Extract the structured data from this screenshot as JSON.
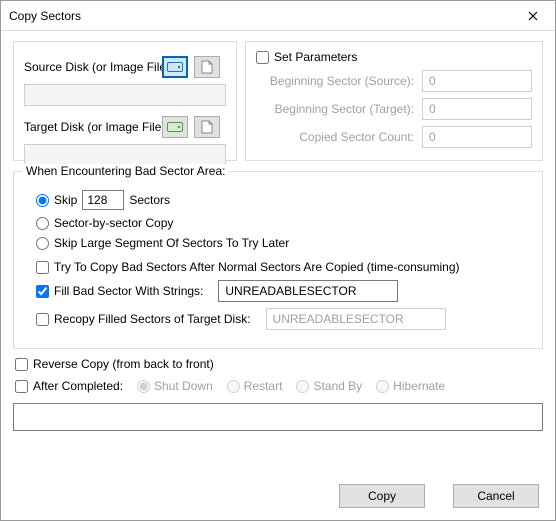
{
  "window": {
    "title": "Copy Sectors"
  },
  "disks": {
    "source_label": "Source Disk (or Image File)",
    "target_label": "Target Disk (or Image File)",
    "source_path": "",
    "target_path": ""
  },
  "params": {
    "set_label": "Set Parameters",
    "set_checked": false,
    "begin_source_label": "Beginning Sector (Source):",
    "begin_source_value": "0",
    "begin_target_label": "Beginning Sector (Target):",
    "begin_target_value": "0",
    "count_label": "Copied Sector Count:",
    "count_value": "0"
  },
  "bad": {
    "legend": "When Encountering Bad Sector Area:",
    "mode": "skip",
    "skip_label": "Skip",
    "skip_value": "128",
    "skip_unit": "Sectors",
    "sector_by_sector_label": "Sector-by-sector Copy",
    "skip_large_label": "Skip Large Segment Of Sectors To Try Later",
    "try_after_label": "Try To Copy Bad Sectors After Normal Sectors Are Copied (time-consuming)",
    "try_after_checked": false,
    "fill_label": "Fill Bad Sector With Strings:",
    "fill_checked": true,
    "fill_value": "UNREADABLESECTOR",
    "recopy_label": "Recopy Filled Sectors of Target Disk:",
    "recopy_checked": false,
    "recopy_value": "UNREADABLESECTOR"
  },
  "reverse": {
    "label": "Reverse Copy (from back to front)",
    "checked": false
  },
  "after": {
    "label": "After Completed:",
    "checked": false,
    "options": [
      "Shut Down",
      "Restart",
      "Stand By",
      "Hibernate"
    ],
    "selected": "Shut Down"
  },
  "command_value": "",
  "buttons": {
    "copy": "Copy",
    "cancel": "Cancel"
  }
}
